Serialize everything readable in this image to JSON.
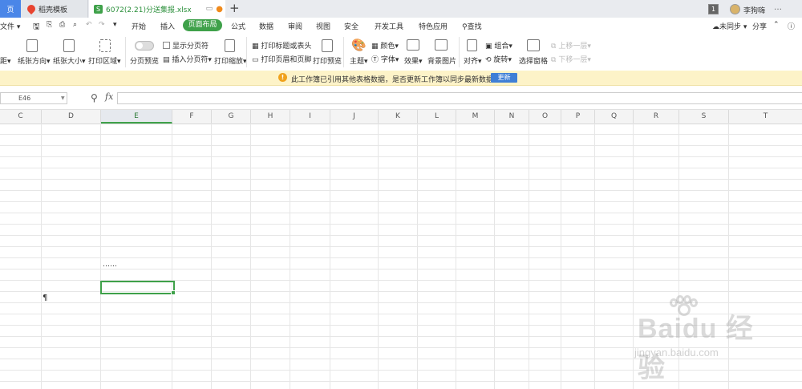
{
  "tabs": {
    "home": "页",
    "daoke": "稻壳模板",
    "file": "6072(2.21)分送集报.xlsx",
    "add": "+"
  },
  "account": {
    "badge": "1",
    "username": "李狗嗨"
  },
  "menu": {
    "file": "文件",
    "items": [
      "开始",
      "插入",
      "页面布局",
      "公式",
      "数据",
      "审阅",
      "视图",
      "安全",
      "开发工具",
      "特色应用"
    ],
    "search": "查找",
    "sync": "未同步",
    "share": "分享"
  },
  "ribbon": {
    "margins": "距",
    "orientation": "纸张方向",
    "size": "纸张大小",
    "print_area": "打印区域",
    "page_break_preview": "分页预览",
    "show_page_breaks": "显示分页符",
    "insert_page_break": "插入分页符",
    "print_scale": "打印缩放",
    "print_titles": "打印标题或表头",
    "print_header_footer": "打印页眉和页脚",
    "print_preview": "打印预览",
    "theme": "主题",
    "colors": "颜色",
    "fonts": "字体",
    "effects": "效果",
    "background": "背景图片",
    "align": "对齐",
    "group": "组合",
    "rotate": "旋转",
    "selection_pane": "选择窗格",
    "bring_forward": "上移一层",
    "send_backward": "下移一层"
  },
  "notify": {
    "message": "此工作簿已引用其他表格数据，是否更新工作簿以同步最新数据？",
    "button": "更新"
  },
  "formula_bar": {
    "name_box": "E46",
    "fx": "fx",
    "value": ""
  },
  "columns": [
    "C",
    "D",
    "E",
    "F",
    "G",
    "H",
    "I",
    "J",
    "K",
    "L",
    "M",
    "N",
    "O",
    "P",
    "Q",
    "R",
    "S",
    "T"
  ],
  "cells": {
    "dots": "……",
    "pilcrow": "¶"
  },
  "watermark": {
    "brand": "Baidu 经验",
    "sub": "jingyan.baidu.com"
  }
}
